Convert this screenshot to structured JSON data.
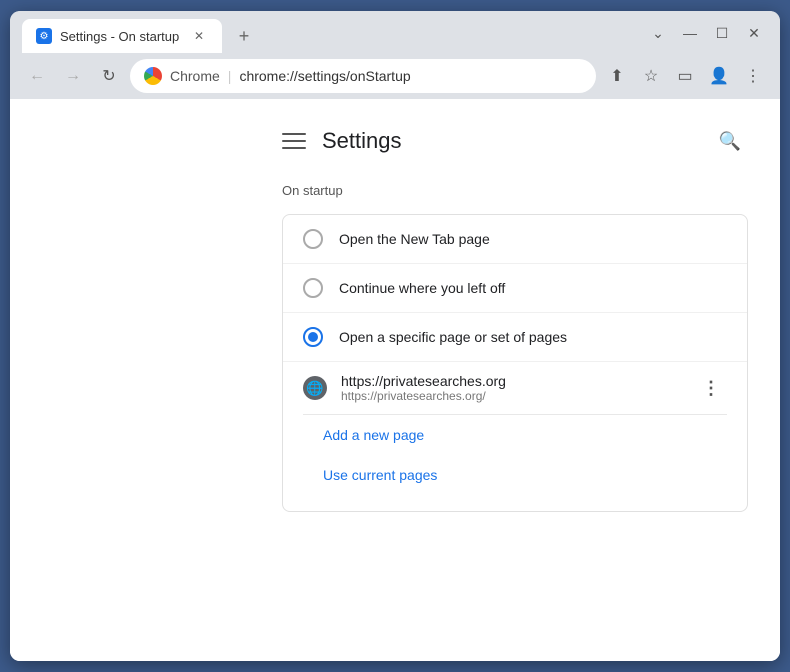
{
  "window": {
    "title": "Settings - On startup",
    "tab_label": "Settings - On startup",
    "controls": {
      "minimize": "—",
      "maximize": "☐",
      "close": "✕",
      "dropdown": "⌄"
    }
  },
  "toolbar": {
    "back_label": "←",
    "forward_label": "→",
    "reload_label": "↻",
    "brand": "Chrome",
    "address": "chrome://settings/onStartup",
    "share_icon": "⬆",
    "bookmark_icon": "☆",
    "sidebar_icon": "▭",
    "profile_icon": "👤",
    "menu_icon": "⋮"
  },
  "settings": {
    "title": "Settings",
    "search_icon": "🔍",
    "section": "On startup",
    "options": [
      {
        "id": "new-tab",
        "label": "Open the New Tab page",
        "selected": false
      },
      {
        "id": "continue",
        "label": "Continue where you left off",
        "selected": false
      },
      {
        "id": "specific",
        "label": "Open a specific page or set of pages",
        "selected": true
      }
    ],
    "startup_pages": [
      {
        "name": "https://privatesearches.org",
        "url": "https://privatesearches.org/"
      }
    ],
    "add_page_label": "Add a new page",
    "use_current_label": "Use current pages"
  }
}
